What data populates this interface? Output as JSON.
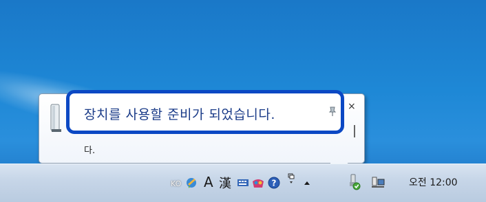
{
  "notification": {
    "title": "장치를 사용할 준비가 되었습니다.",
    "message_tail": "다."
  },
  "tray": {
    "ime_lang": "KO",
    "ime_mode": "A",
    "ime_hanja": "漢",
    "clock": "오전 12:00"
  },
  "colors": {
    "highlight_border": "#0b48c4",
    "title_text": "#1a3b88",
    "desktop_blue": "#1e88d6"
  }
}
